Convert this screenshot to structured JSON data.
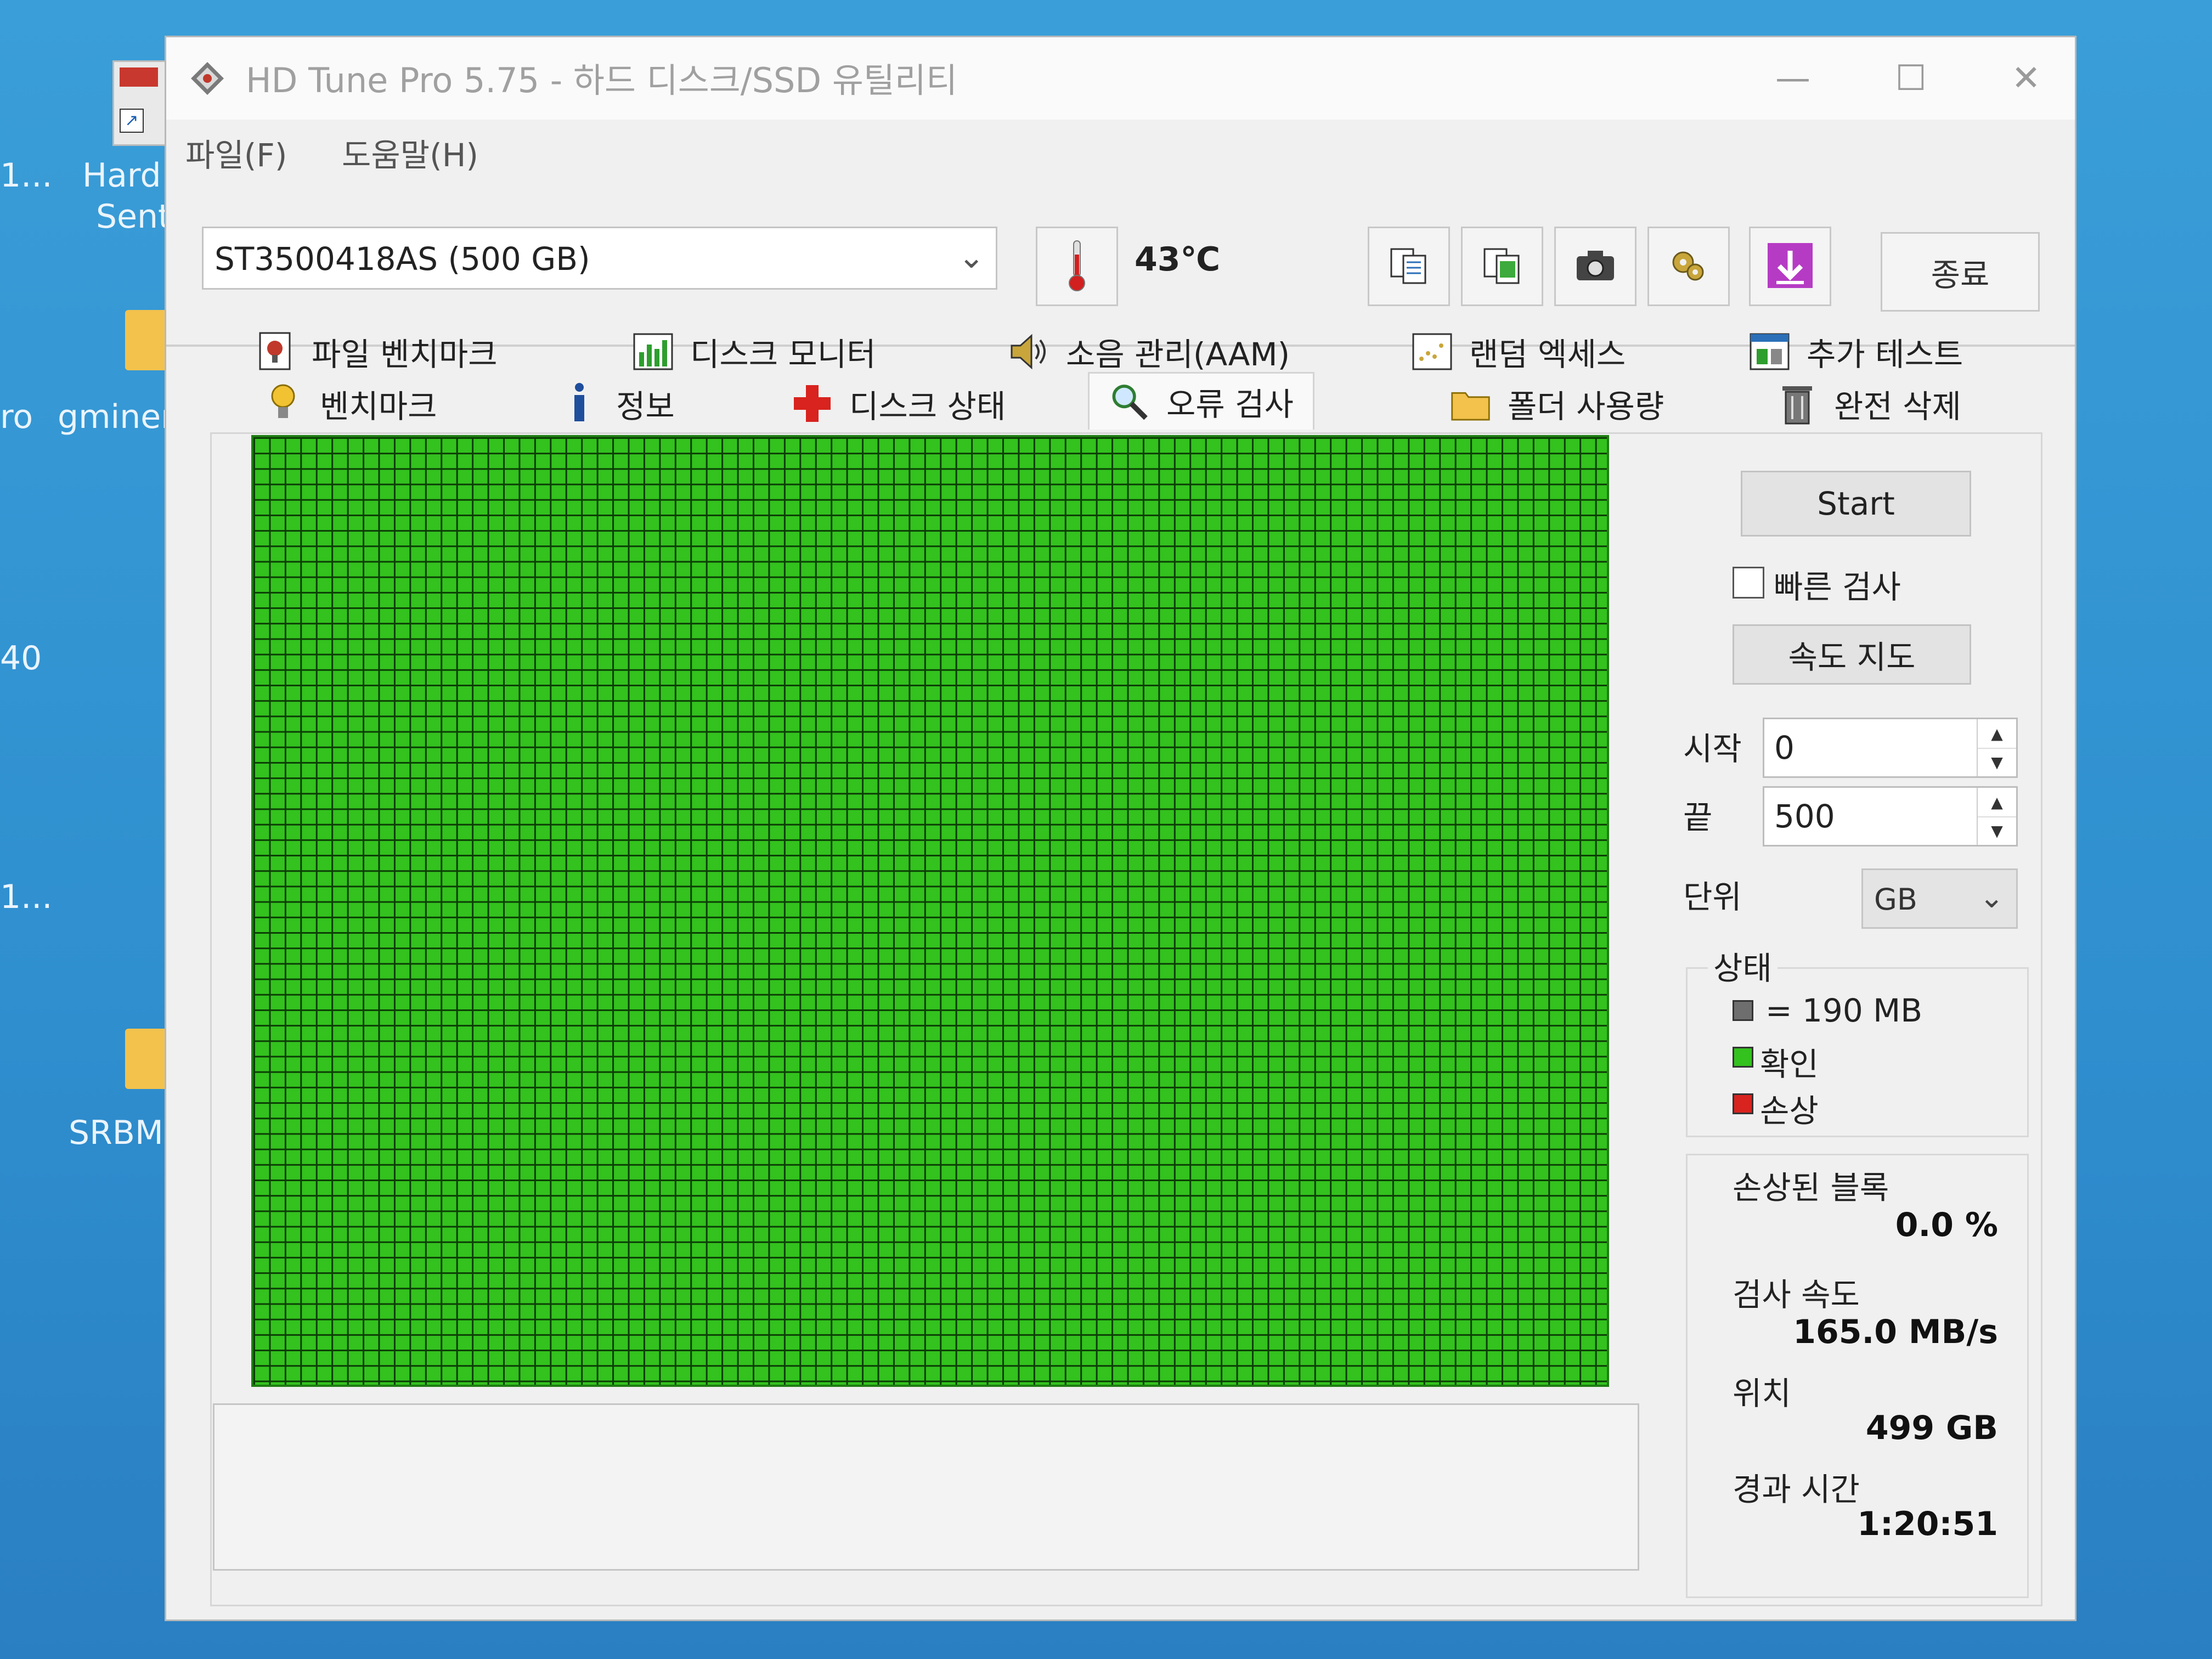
{
  "desktop": {
    "icons": [
      {
        "label_1": "Hard",
        "label_2": "Sent"
      },
      {
        "label": "gminer"
      },
      {
        "label": "SRBMi"
      }
    ],
    "edge_labels": [
      "1...",
      "ro",
      "40",
      "1..."
    ]
  },
  "window": {
    "title": "HD Tune Pro 5.75 - 하드 디스크/SSD 유틸리티",
    "controls": {
      "minimize": "—",
      "maximize": "☐",
      "close": "✕"
    }
  },
  "menu": {
    "file": "파일(F)",
    "help": "도움말(H)"
  },
  "toolbar": {
    "drive": "ST3500418AS (500 GB)",
    "temperature": "43℃",
    "exit": "종료",
    "icons": [
      "copy-text-icon",
      "copy-screenshot-icon",
      "camera-icon",
      "options-icon",
      "save-icon"
    ]
  },
  "tabs": {
    "row1": [
      "파일 벤치마크",
      "디스크 모니터",
      "소음 관리(AAM)",
      "랜덤 엑세스",
      "추가 테스트"
    ],
    "row2": [
      "벤치마크",
      "정보",
      "디스크 상태",
      "오류 검사",
      "폴더 사용량",
      "완전 삭제"
    ],
    "active": "오류 검사"
  },
  "error_scan": {
    "start_button": "Start",
    "quick_scan_label": "빠른 검사",
    "quick_scan_checked": false,
    "speed_map_button": "속도 지도",
    "start_label": "시작",
    "start_value": "0",
    "end_label": "끝",
    "end_value": "500",
    "unit_label": "단위",
    "unit_value": "GB",
    "legend": {
      "title": "상태",
      "block_size": "= 190 MB",
      "ok": "확인",
      "damaged": "손상",
      "colors": {
        "block": "#6e6e6e",
        "ok": "#33c21e",
        "damaged": "#d8231e"
      }
    },
    "stats": {
      "damaged_blocks_label": "손상된 블록",
      "damaged_blocks_value": "0.0 %",
      "scan_speed_label": "검사 속도",
      "scan_speed_value": "165.0 MB/s",
      "position_label": "위치",
      "position_value": "499 GB",
      "elapsed_label": "경과 시간",
      "elapsed_value": "1:20:51"
    },
    "block_map": {
      "status": "all blocks ok",
      "color": "#33c21e"
    }
  }
}
